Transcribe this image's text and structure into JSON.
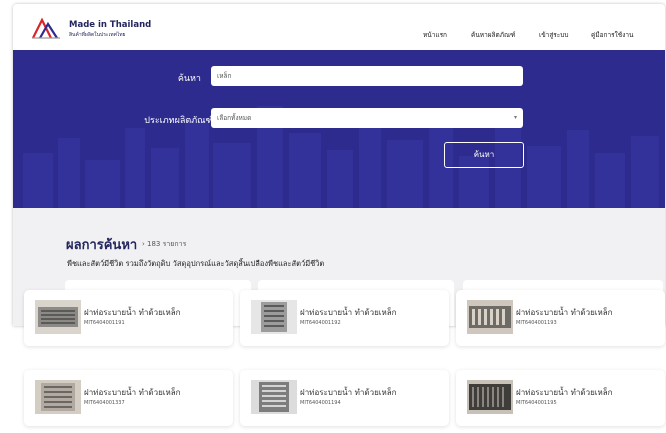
{
  "header": {
    "brand_title": "Made in Thailand",
    "brand_subtitle": "สินค้าที่ผลิตในประเทศไทย",
    "nav": [
      "หน้าแรก",
      "ค้นหาผลิตภัณฑ์",
      "เข้าสู่ระบบ",
      "คู่มือการใช้งาน"
    ]
  },
  "search": {
    "keyword_label": "ค้นหา",
    "keyword_value": "เหล็ก",
    "type_label": "ประเภทผลิตภัณฑ์",
    "type_value": "เลือกทั้งหมด",
    "button_label": "ค้นหา"
  },
  "results": {
    "title": "ผลการค้นหา",
    "count": "› 183 รายการ",
    "description": "พืชและสัตว์มีชีวิต รวมถึงวัตถุดิบ วัสดุอุปกรณ์และวัสดุสิ้นเปลืองพืชและสัตว์มีชีวิต"
  },
  "products": [
    {
      "name": "ฝาท่อระบายน้ำ ทำด้วยเหล็ก",
      "code": "MIT6404001191"
    },
    {
      "name": "ฝาท่อระบายน้ำ ทำด้วยเหล็ก",
      "code": "MIT6404001192"
    },
    {
      "name": "ฝาท่อระบายน้ำ ทำด้วยเหล็ก",
      "code": "MIT6404001193"
    },
    {
      "name": "ฝาท่อระบายน้ำ ทำด้วยเหล็ก",
      "code": "MIT6404001337"
    },
    {
      "name": "ฝาท่อระบายน้ำ ทำด้วยเหล็ก",
      "code": "MIT6404001194"
    },
    {
      "name": "ฝาท่อระบายน้ำ ทำด้วยเหล็ก",
      "code": "MIT6404001195"
    }
  ],
  "colors": {
    "hero": "#2d2c8e",
    "brand": "#23265e",
    "background": "#f1f1f3"
  }
}
